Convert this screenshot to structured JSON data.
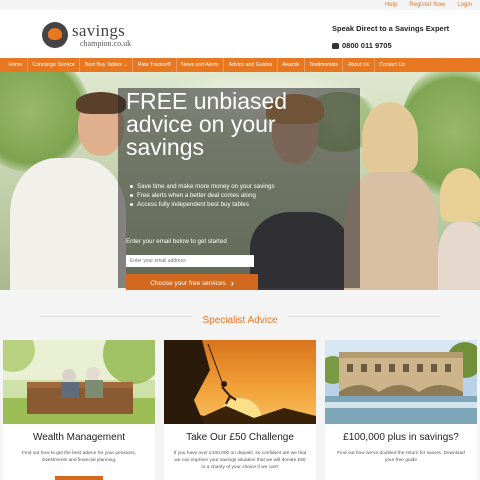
{
  "util_links": [
    "Help",
    "Register Now",
    "Login"
  ],
  "brand": {
    "name": "savings",
    "domain": "champion.co.uk"
  },
  "contact": {
    "title": "Speak Direct to a Savings Expert",
    "phone": "0800 011 9705"
  },
  "nav": [
    "Home",
    "Concierge Service",
    "Best Buy Tables ⌄",
    "Rate Tracker®",
    "News and Alerts",
    "Advice and Guides",
    "Awards",
    "Testimonials",
    "About Us",
    "Contact Us"
  ],
  "hero": {
    "title": "FREE unbiased advice on your savings",
    "bullets": [
      "Save time and make more money on your savings",
      "Free alerts when a better deal comes along",
      "Access fully independent best buy tables"
    ],
    "prompt": "Enter your email below to get started",
    "email_placeholder": "Enter your email address",
    "cta": "Choose your free services",
    "cta_icon": "›"
  },
  "section_title": "Specialist Advice",
  "cards": [
    {
      "title": "Wealth Management",
      "text": "Find out how to get the best advice for your pensions, investments and financial planning."
    },
    {
      "title": "Take Our £50 Challenge",
      "text": "If you have over £100,000 on deposit, so confident are we that we can improve your savings situation that we will donate £50 to a charity of your choice if we can't"
    },
    {
      "title": "£100,000 plus in savings?",
      "text": "Find out how we've doubled the return for savers. Download your free guide"
    }
  ],
  "colors": {
    "accent": "#e87722",
    "button": "#d2691e"
  }
}
